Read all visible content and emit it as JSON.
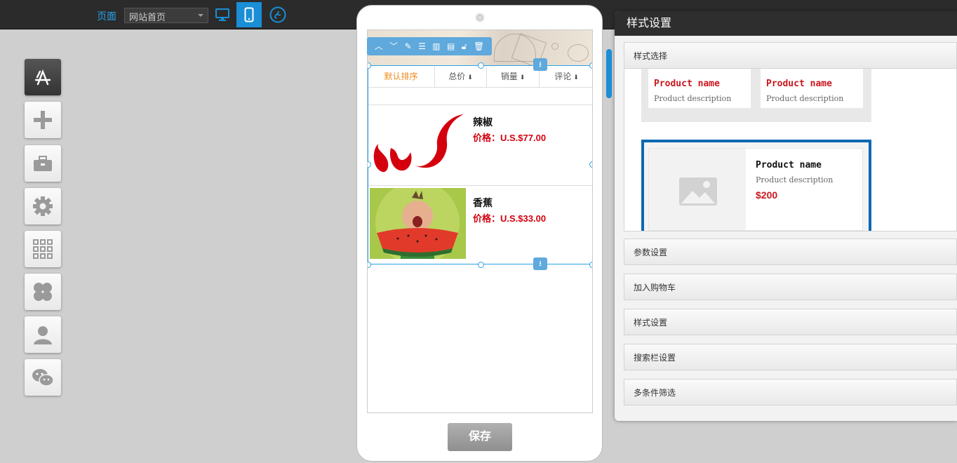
{
  "topbar": {
    "page_label": "页面",
    "page_select_value": "网站首页",
    "icons": [
      "desktop-icon",
      "mobile-icon",
      "miniprogram-icon"
    ],
    "accent_color": "#1a8ed6"
  },
  "sidebar": {
    "items": [
      "app-store-icon",
      "plus-icon",
      "toolbox-icon",
      "gear-icon",
      "grid-icon",
      "clover-icon",
      "user-icon",
      "wechat-icon"
    ]
  },
  "phone": {
    "sort": {
      "items": [
        {
          "label": "默认排序",
          "arrow": ""
        },
        {
          "label": "总价",
          "arrow": "⬇"
        },
        {
          "label": "销量",
          "arrow": "⬇"
        },
        {
          "label": "评论",
          "arrow": "⬇"
        }
      ],
      "active_color": "#f08d1e"
    },
    "products": [
      {
        "name": "辣椒",
        "price": "价格：U.S.$77.00"
      },
      {
        "name": "香蕉",
        "price": "价格：U.S.$33.00"
      }
    ],
    "price_color": "#d4000e",
    "save_label": "保存"
  },
  "panel": {
    "title": "样式设置",
    "sections": {
      "style_select": "样式选择",
      "params": "参数设置",
      "cart": "加入购物车",
      "style": "样式设置",
      "search": "搜索栏设置",
      "filter": "多条件筛选"
    },
    "style_options": {
      "grid_cards": [
        {
          "name": "Product name",
          "desc": "Product description"
        },
        {
          "name": "Product name",
          "desc": "Product description"
        }
      ],
      "list_card": {
        "name": "Product name",
        "desc": "Product description",
        "price": "$200"
      }
    },
    "selected_color": "#0d67b3"
  }
}
